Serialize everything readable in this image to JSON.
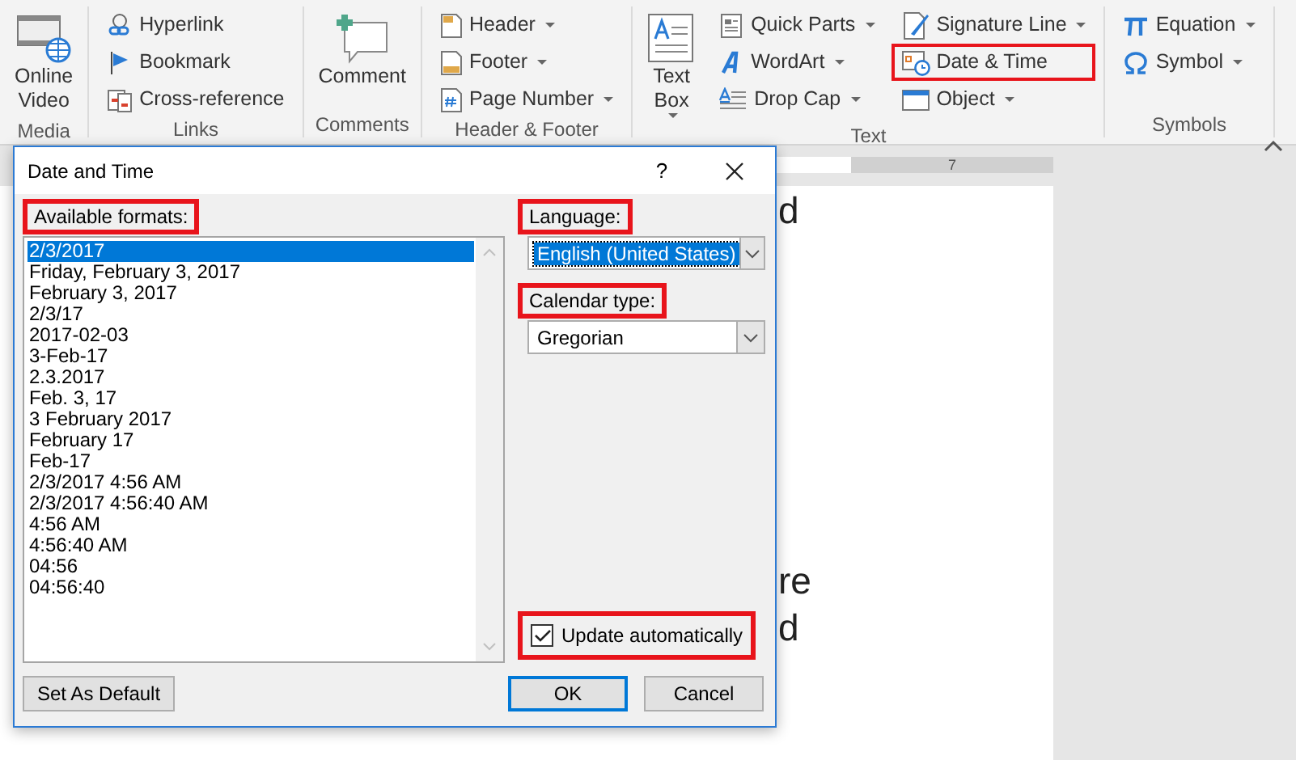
{
  "ribbon": {
    "groups": [
      {
        "label": "Media",
        "columns": [
          [
            {
              "kind": "large",
              "label": "Online Video",
              "dropdown": false,
              "highlighted": false
            }
          ]
        ]
      },
      {
        "label": "Links",
        "columns": [
          [
            {
              "kind": "small",
              "label": "Hyperlink",
              "dropdown": false,
              "highlighted": false
            },
            {
              "kind": "small",
              "label": "Bookmark",
              "dropdown": false,
              "highlighted": false
            },
            {
              "kind": "small",
              "label": "Cross-reference",
              "dropdown": false,
              "highlighted": false
            }
          ]
        ]
      },
      {
        "label": "Comments",
        "columns": [
          [
            {
              "kind": "large",
              "label": "Comment",
              "dropdown": false,
              "highlighted": false
            }
          ]
        ]
      },
      {
        "label": "Header & Footer",
        "columns": [
          [
            {
              "kind": "small",
              "label": "Header",
              "dropdown": true,
              "highlighted": false
            },
            {
              "kind": "small",
              "label": "Footer",
              "dropdown": true,
              "highlighted": false
            },
            {
              "kind": "small",
              "label": "Page Number",
              "dropdown": true,
              "highlighted": false
            }
          ]
        ]
      },
      {
        "label": "Text",
        "columns": [
          [
            {
              "kind": "large",
              "label": "Text Box",
              "dropdown": true,
              "highlighted": false
            }
          ],
          [
            {
              "kind": "small",
              "label": "Quick Parts",
              "dropdown": true,
              "highlighted": false
            },
            {
              "kind": "small",
              "label": "WordArt",
              "dropdown": true,
              "highlighted": false
            },
            {
              "kind": "small",
              "label": "Drop Cap",
              "dropdown": true,
              "highlighted": false
            }
          ],
          [
            {
              "kind": "small",
              "label": "Signature Line",
              "dropdown": true,
              "highlighted": false
            },
            {
              "kind": "small",
              "label": "Date & Time",
              "dropdown": false,
              "highlighted": true
            },
            {
              "kind": "small",
              "label": "Object",
              "dropdown": true,
              "highlighted": false
            }
          ]
        ]
      },
      {
        "label": "Symbols",
        "columns": [
          [
            {
              "kind": "small",
              "label": "Equation",
              "dropdown": true,
              "highlighted": false
            },
            {
              "kind": "small",
              "label": "Symbol",
              "dropdown": true,
              "highlighted": false
            }
          ]
        ]
      }
    ]
  },
  "ruler": {
    "mark": "7"
  },
  "document": {
    "lines": [
      {
        "text": "d"
      },
      {
        "text": "re"
      },
      {
        "text": "d"
      }
    ]
  },
  "dialog": {
    "title": "Date and Time",
    "help": "?",
    "formats": {
      "label": "Available formats:",
      "highlighted": true,
      "items": [
        {
          "text": "2/3/2017",
          "selected": true
        },
        {
          "text": "Friday, February 3, 2017",
          "selected": false
        },
        {
          "text": "February 3, 2017",
          "selected": false
        },
        {
          "text": "2/3/17",
          "selected": false
        },
        {
          "text": "2017-02-03",
          "selected": false
        },
        {
          "text": "3-Feb-17",
          "selected": false
        },
        {
          "text": "2.3.2017",
          "selected": false
        },
        {
          "text": "Feb. 3, 17",
          "selected": false
        },
        {
          "text": "3 February 2017",
          "selected": false
        },
        {
          "text": "February 17",
          "selected": false
        },
        {
          "text": "Feb-17",
          "selected": false
        },
        {
          "text": "2/3/2017 4:56 AM",
          "selected": false
        },
        {
          "text": "2/3/2017 4:56:40 AM",
          "selected": false
        },
        {
          "text": "4:56 AM",
          "selected": false
        },
        {
          "text": "4:56:40 AM",
          "selected": false
        },
        {
          "text": "04:56",
          "selected": false
        },
        {
          "text": "04:56:40",
          "selected": false
        }
      ]
    },
    "language": {
      "label": "Language:",
      "highlighted": true,
      "value": "English (United States)",
      "focused": true
    },
    "calendar": {
      "label": "Calendar type:",
      "highlighted": true,
      "value": "Gregorian",
      "focused": false
    },
    "update": {
      "label": "Update automatically",
      "checked": true,
      "highlighted": true
    },
    "buttons": [
      {
        "label": "Set As Default",
        "default": false
      },
      {
        "label": "OK",
        "default": true
      },
      {
        "label": "Cancel",
        "default": false
      }
    ]
  }
}
